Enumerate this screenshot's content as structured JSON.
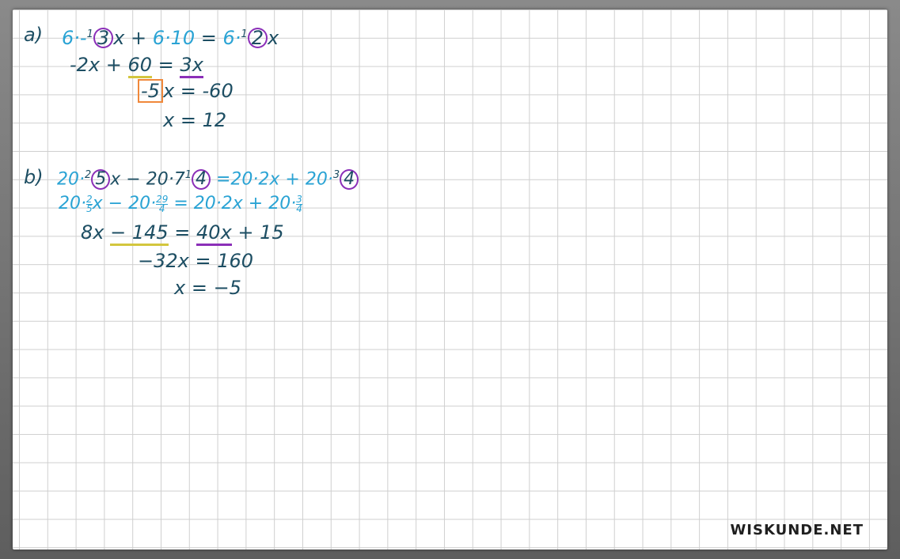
{
  "part_a": {
    "label": "a)",
    "line1": {
      "t1": "6·-",
      "sup1": "1",
      "c1": "3",
      "t2": "x + ",
      "t3": "6·10",
      "t4": " = ",
      "t5": "6·",
      "sup2": "1",
      "c2": "2",
      "t6": "x"
    },
    "line2": {
      "t1": "-2x + ",
      "u1": "60",
      "t2": " = ",
      "u2": "3x"
    },
    "line3": {
      "box": "-5",
      "t1": "x = -60"
    },
    "line4": "x = 12"
  },
  "part_b": {
    "label": "b)",
    "line1": {
      "t1": "20·",
      "sup1": "2",
      "c1": "5",
      "t2": "x − 20·7",
      "sup2": "1",
      "c2": "4",
      "t3": " =20·2x + 20·",
      "sup3": "3",
      "c3": "4"
    },
    "line2": {
      "t1": "20·",
      "f1n": "2",
      "f1d": "5",
      "t2": "x − 20·",
      "f2n": "29",
      "f2d": "4",
      "t3": " = 20·2x + 20·",
      "f3n": "3",
      "f3d": "4"
    },
    "line3": {
      "t1": "8x ",
      "u1": "− 145",
      "t2": " = ",
      "u2": "40x",
      "t3": " + 15"
    },
    "line4": "−32x = 160",
    "line5": "x = −5"
  },
  "brand": "WISKUNDE.NET"
}
